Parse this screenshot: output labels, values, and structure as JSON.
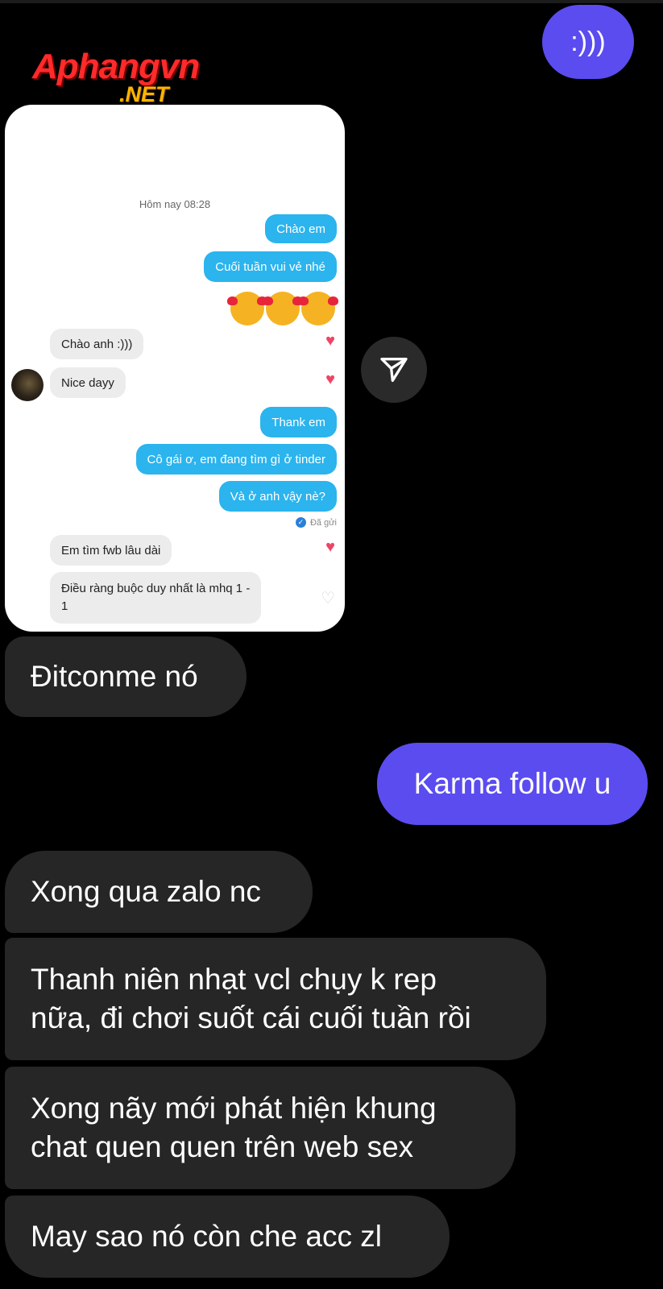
{
  "watermark": {
    "main": "Aphangvn",
    "net": ".NET"
  },
  "messages": {
    "top_sent": ":)))",
    "received_1": "Đitconme nó",
    "sent_1": "Karma follow u",
    "received_2": "Xong qua zalo nc",
    "received_3_line1": "Thanh niên nhạt vcl chụy k rep",
    "received_3_line2": "nữa, đi chơi suốt cái cuối tuần rồi",
    "received_4_line1": "Xong nãy mới phát hiện khung",
    "received_4_line2": "chat quen quen trên web sex",
    "received_5": "May sao nó còn che acc zl"
  },
  "screenshot": {
    "timestamp": "Hôm nay 08:28",
    "msg_me_1": "Chào em",
    "msg_me_2": "Cuối tuần vui vẻ nhé",
    "msg_them_1": "Chào anh :)))",
    "msg_them_2": "Nice dayy",
    "msg_me_3": "Thank em",
    "msg_me_4": "Cô gái ơ, em đang tìm gì ở tinder",
    "msg_me_5": "Và ở anh vậy nè?",
    "seen_label": "Đã gửi",
    "msg_them_3": "Em tìm fwb lâu dài",
    "msg_them_4_line1": "Điều ràng buộc duy nhất là mhq 1 -",
    "msg_them_4_line2": "1"
  },
  "icons": {
    "share": "send-icon",
    "heart": "heart-icon",
    "emoji": "smiling-face-with-hearts-icon"
  },
  "colors": {
    "sent_bubble": "#5b4cf0",
    "received_bubble": "#262626",
    "inner_sent": "#2bb4ee",
    "inner_received": "#ececec"
  }
}
